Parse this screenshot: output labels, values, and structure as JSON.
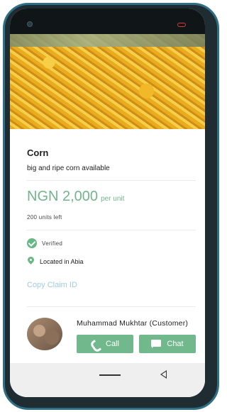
{
  "product": {
    "name": "Corn",
    "description": "big and ripe corn available",
    "price": "NGN 2,000",
    "price_suffix": "per unit",
    "stock": "200 units left",
    "verified_label": "Verified",
    "location": "Located in Abia",
    "copy_claim_label": "Copy Claim ID"
  },
  "seller": {
    "name": "Muhammad Mukhtar (Customer)",
    "call_label": "Call",
    "chat_label": "Chat"
  },
  "icons": {
    "verified": "check-circle-icon",
    "location": "map-pin-icon",
    "call": "phone-icon",
    "chat": "chat-bubble-icon",
    "nav_home": "home-bar-icon",
    "nav_back": "back-triangle-icon"
  },
  "colors": {
    "accent": "#71b88c",
    "price": "#72b58d",
    "link": "#9fcbe4"
  }
}
